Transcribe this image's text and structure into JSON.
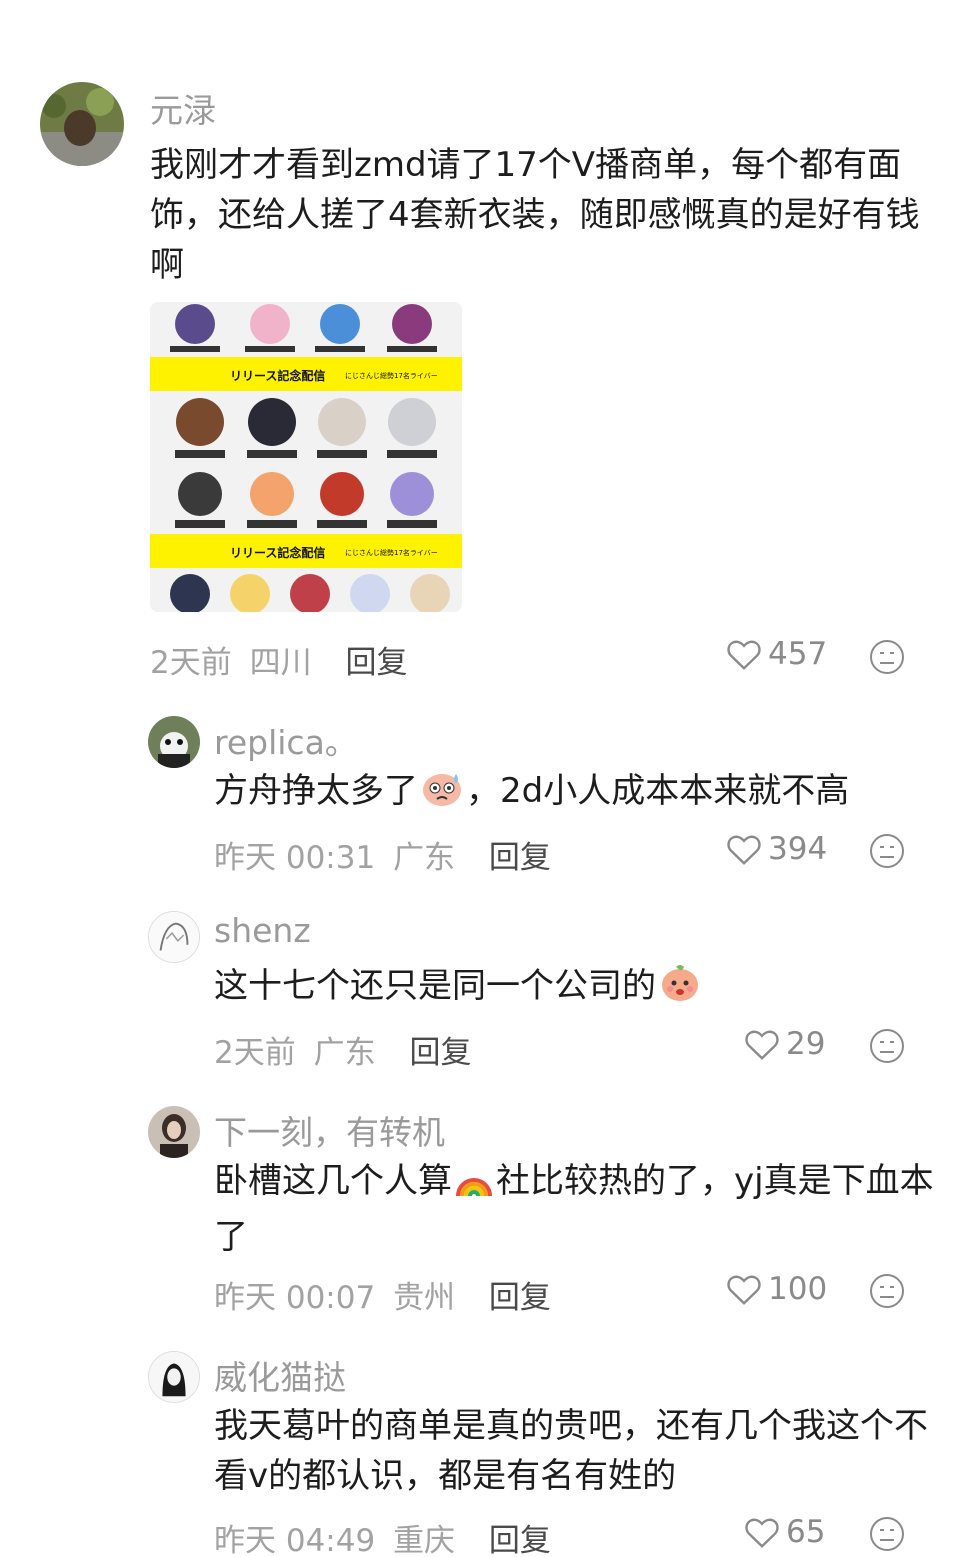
{
  "comments": [
    {
      "username": "元渌",
      "text": "我刚才才看到zmd请了17个V播商单，每个都有面饰，还给人搓了4套新衣装，随即感慨真的是好有钱啊",
      "time": "2天前",
      "location": "四川",
      "reply_label": "回复",
      "likes": "457",
      "image": {
        "banner_title": "リリース記念配信",
        "banner_subtitle": "にじさんじ総勢17名ライバー"
      }
    },
    {
      "username": "replica。",
      "text_before_emoji": "方舟挣太多了",
      "emoji": "sweat-face-emoji",
      "text_after_emoji": "，2d小人成本本来就不高",
      "time": "昨天 00:31",
      "location": "广东",
      "reply_label": "回复",
      "likes": "394"
    },
    {
      "username": "shenz",
      "text_before_emoji": "这十七个还只是同一个公司的",
      "emoji": "peach-face-emoji",
      "time": "2天前",
      "location": "广东",
      "reply_label": "回复",
      "likes": "29"
    },
    {
      "username": "下一刻，有转机",
      "text_before_emoji": "卧槽这几个人算",
      "emoji": "rainbow-emoji",
      "text_after_emoji": "社比较热的了，yj真是下血本了",
      "time": "昨天 00:07",
      "location": "贵州",
      "reply_label": "回复",
      "likes": "100"
    },
    {
      "username": "威化猫挞",
      "text": "我天葛叶的商单是真的贵吧，还有几个我这个不看v的都认识，都是有名有姓的",
      "time": "昨天 04:49",
      "location": "重庆",
      "reply_label": "回复",
      "likes": "65"
    }
  ],
  "colors": {
    "username": "#9a9a9a",
    "meta": "#a2a2a2",
    "banner": "#fff200"
  }
}
